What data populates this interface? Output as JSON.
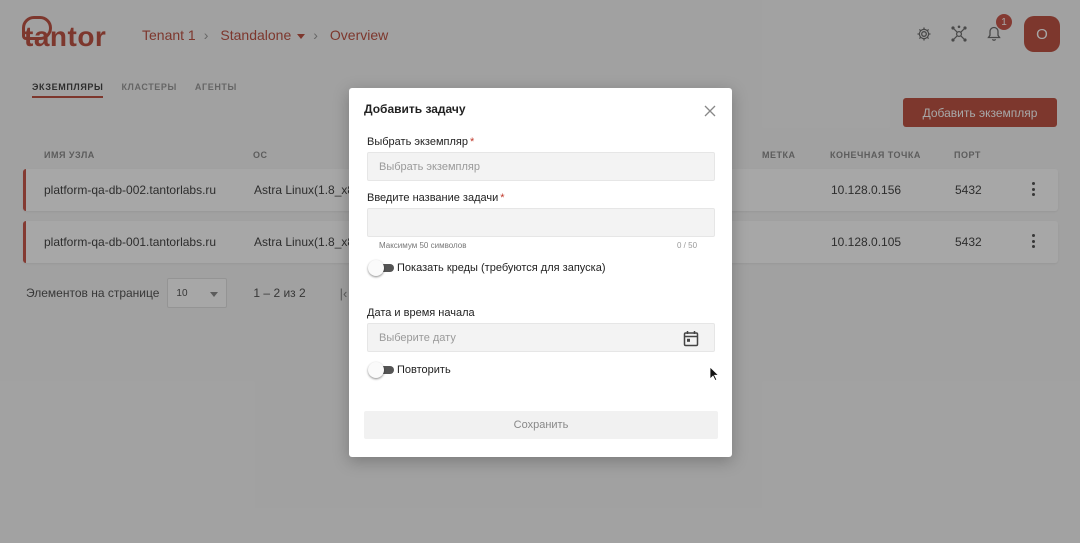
{
  "header": {
    "brand": "tantor",
    "breadcrumb": {
      "tenant": "Tenant 1",
      "cluster": "Standalone",
      "page": "Overview"
    },
    "notifications_count": "1",
    "avatar_initial": "O"
  },
  "tabs": [
    {
      "label": "ЭКЗЕМПЛЯРЫ",
      "active": true
    },
    {
      "label": "КЛАСТЕРЫ",
      "active": false
    },
    {
      "label": "АГЕНТЫ",
      "active": false
    }
  ],
  "add_instance_label": "Добавить экземпляр",
  "table": {
    "columns": {
      "host": "ИМЯ УЗЛА",
      "os": "ОС",
      "tag": "МЕТКА",
      "endpoint": "КОНЕЧНАЯ ТОЧКА",
      "port": "ПОРТ"
    },
    "rows": [
      {
        "host": "platform-qa-db-002.tantorlabs.ru",
        "os": "Astra Linux(1.8_x86",
        "endpoint": "10.128.0.156",
        "port": "5432"
      },
      {
        "host": "platform-qa-db-001.tantorlabs.ru",
        "os": "Astra Linux(1.8_x86",
        "endpoint": "10.128.0.105",
        "port": "5432"
      }
    ]
  },
  "pager": {
    "per_page_label": "Элементов на странице",
    "per_page_value": "10",
    "range": "1 – 2 из 2"
  },
  "modal": {
    "title": "Добавить задачу",
    "instance_label": "Выбрать экземпляр",
    "instance_placeholder": "Выбрать экземпляр",
    "task_name_label": "Введите название задачи",
    "task_name_value": "",
    "task_name_hint": "Максимум 50 символов",
    "task_name_counter": "0 / 50",
    "show_creds_label": "Показать креды (требуются для запуска)",
    "start_label": "Дата и время начала",
    "date_placeholder": "Выберите дату",
    "repeat_label": "Повторить",
    "save_label": "Сохранить"
  },
  "colors": {
    "brand": "#b23321",
    "required": "#c0392b"
  }
}
